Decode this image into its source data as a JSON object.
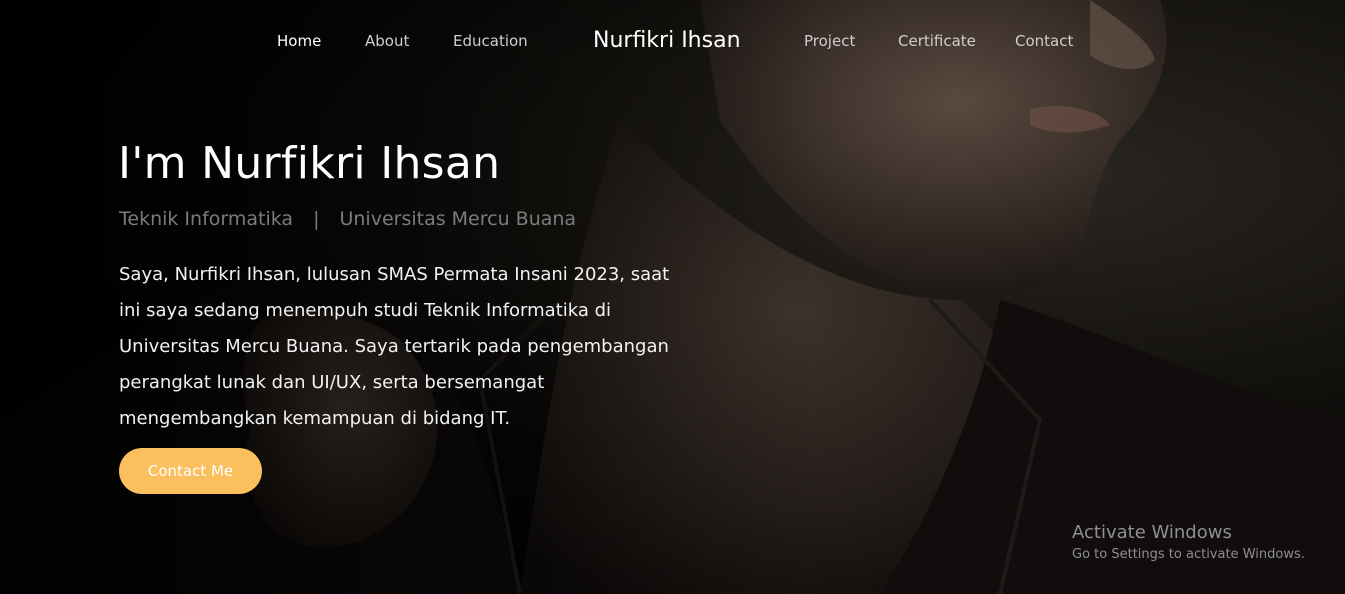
{
  "nav": {
    "items": [
      {
        "label": "Home",
        "active": true
      },
      {
        "label": "About"
      },
      {
        "label": "Education"
      },
      {
        "label": "Project"
      },
      {
        "label": "Certificate"
      },
      {
        "label": "Contact"
      }
    ],
    "brand": "Nurfikri Ihsan"
  },
  "hero": {
    "title": "I'm Nurfikri Ihsan",
    "subtitle_major": "Teknik Informatika",
    "subtitle_separator": "|",
    "subtitle_university": "Universitas Mercu Buana",
    "description": "Saya, Nurfikri Ihsan, lulusan SMAS Permata Insani 2023, saat ini saya sedang menempuh studi Teknik Informatika di Universitas Mercu Buana. Saya tertarik pada pengembangan perangkat lunak dan UI/UX, serta bersemangat mengembangkan kemampuan di bidang IT.",
    "cta_label": "Contact Me"
  },
  "watermark": {
    "title": "Activate Windows",
    "subtitle": "Go to Settings to activate Windows."
  },
  "colors": {
    "accent": "#fbbf5d",
    "background": "#000000",
    "subtitle": "#7c7c7c"
  }
}
